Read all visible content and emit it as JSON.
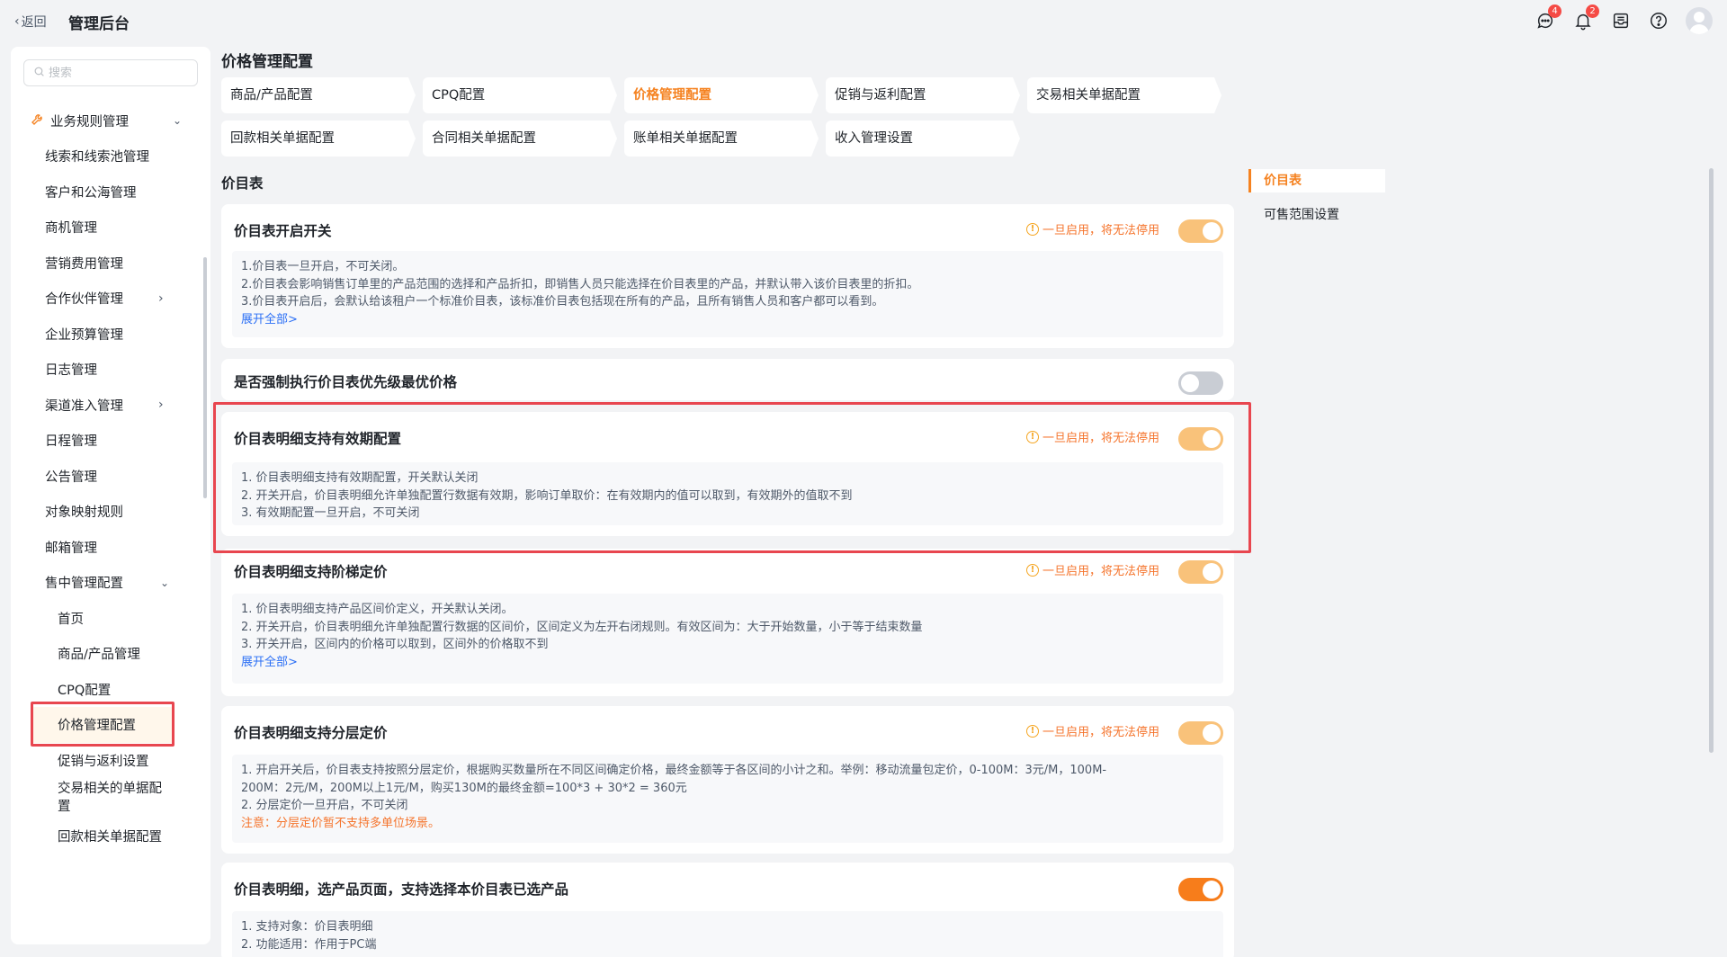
{
  "header": {
    "back_label": "返回",
    "app_title": "管理后台",
    "icons": [
      {
        "name": "message-icon",
        "badge": "4"
      },
      {
        "name": "bell-icon",
        "badge": "2"
      },
      {
        "name": "inbox-icon"
      },
      {
        "name": "help-icon"
      },
      {
        "name": "avatar"
      }
    ]
  },
  "sidebar": {
    "search_placeholder": "搜索",
    "group_label": "业务规则管理",
    "items": [
      "线索和线索池管理",
      "客户和公海管理",
      "商机管理",
      "营销费用管理",
      "合作伙伴管理",
      "企业预算管理",
      "日志管理",
      "渠道准入管理",
      "日程管理",
      "公告管理",
      "对象映射规则",
      "邮箱管理",
      "售中管理配置"
    ],
    "sub_items": [
      "首页",
      "商品/产品管理",
      "CPQ配置",
      "价格管理配置",
      "促销与返利设置",
      "交易相关的单据配置",
      "回款相关单据配置"
    ],
    "active_item": "价格管理配置"
  },
  "main": {
    "page_title": "价格管理配置",
    "tabs": [
      "商品/产品配置",
      "CPQ配置",
      "价格管理配置",
      "促销与返利配置",
      "交易相关单据配置",
      "回款相关单据配置",
      "合同相关单据配置",
      "账单相关单据配置",
      "收入管理设置"
    ],
    "active_tab": "价格管理配置",
    "section_title": "价目表",
    "warn_text": "一旦启用，将无法停用",
    "expand_label": "展开全部>",
    "cards": [
      {
        "title": "价目表开启开关",
        "toggle": "on",
        "lines": [
          "1.价目表一旦开启，不可关闭。",
          "2.价目表会影响销售订单里的产品范围的选择和产品折扣，即销售人员只能选择在价目表里的产品，并默认带入该价目表里的折扣。",
          "3.价目表开启后，会默认给该租户一个标准价目表，该标准价目表包括现在所有的产品，且所有销售人员和客户都可以看到。"
        ]
      },
      {
        "title": "是否强制执行价目表优先级最优价格",
        "toggle": "off"
      },
      {
        "title": "价目表明细支持有效期配置",
        "toggle": "on",
        "lines": [
          "1. 价目表明细支持有效期配置，开关默认关闭",
          "2. 开关开启，价目表明细允许单独配置行数据有效期，影响订单取价：在有效期内的值可以取到，有效期外的值取不到",
          "3. 有效期配置一旦开启，不可关闭"
        ]
      },
      {
        "title": "价目表明细支持阶梯定价",
        "toggle": "on",
        "lines": [
          "1. 价目表明细支持产品区间价定义，开关默认关闭。",
          "2. 开关开启，价目表明细允许单独配置行数据的区间价，区间定义为左开右闭规则。有效区间为：大于开始数量，小于等于结束数量",
          "3. 开关开启，区间内的价格可以取到，区间外的价格取不到"
        ]
      },
      {
        "title": "价目表明细支持分层定价",
        "toggle": "on",
        "lines": [
          "1. 开启开关后，价目表支持按照分层定价，根据购买数量所在不同区间确定价格，最终金额等于各区间的小计之和。举例：移动流量包定价，0-100M：3元/M，100M-",
          "200M：2元/M，200M以上1元/M，购买130M的最终金额=100*3 + 30*2 = 360元",
          "2. 分层定价一旦开启，不可关闭"
        ],
        "note": "注意：分层定价暂不支持多单位场景。"
      },
      {
        "title": "价目表明细，选产品页面，支持选择本价目表已选产品",
        "toggle": "on",
        "lines": [
          "1. 支持对象：价目表明细",
          "2. 功能适用：作用于PC端"
        ]
      }
    ]
  },
  "anchor_nav": {
    "items": [
      "价目表",
      "可售范围设置"
    ],
    "active": "价目表"
  },
  "colors": {
    "accent": "#f58220",
    "toggle_on": "#f9c27a",
    "toggle_on_strong": "#f77d1b",
    "toggle_off": "#c9cdd4",
    "warning_text": "#f5742c",
    "link": "#2b6ff5",
    "highlight_border": "#e8464f"
  }
}
